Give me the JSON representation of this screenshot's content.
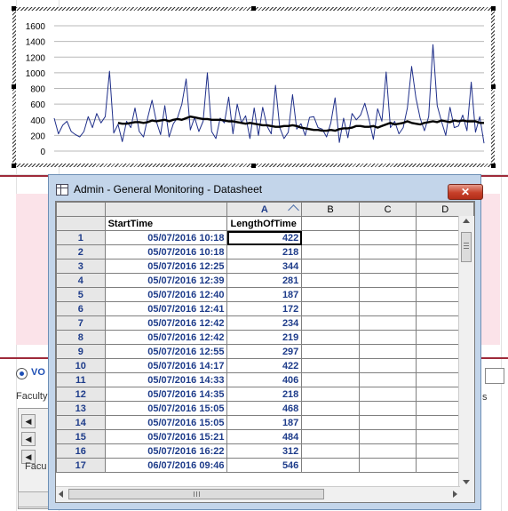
{
  "chart_data": {
    "type": "line",
    "y_ticks": [
      "0",
      "200",
      "400",
      "600",
      "800",
      "1000",
      "1200",
      "1400",
      "1600"
    ],
    "ylim": [
      0,
      1600
    ],
    "grid": true,
    "series": [
      {
        "style": "thin navy line",
        "values": [
          420,
          220,
          330,
          380,
          250,
          210,
          180,
          250,
          440,
          300,
          480,
          360,
          440,
          1020,
          230,
          340,
          120,
          380,
          300,
          550,
          250,
          180,
          430,
          650,
          380,
          210,
          580,
          180,
          350,
          430,
          600,
          920,
          270,
          430,
          250,
          380,
          1000,
          250,
          160,
          420,
          360,
          690,
          220,
          600,
          360,
          450,
          160,
          550,
          200,
          560,
          320,
          220,
          840,
          300,
          160,
          240,
          720,
          280,
          350,
          200,
          430,
          440,
          300,
          280,
          180,
          360,
          680,
          110,
          420,
          170,
          480,
          400,
          460,
          610,
          400,
          150,
          540,
          380,
          1010,
          300,
          380,
          220,
          300,
          550,
          1080,
          680,
          420,
          260,
          440,
          1360,
          580,
          380,
          200,
          560,
          300,
          320,
          460,
          260,
          880,
          240,
          440,
          100
        ]
      },
      {
        "style": "thick black trend line",
        "values": [
          null,
          null,
          null,
          null,
          null,
          null,
          null,
          null,
          null,
          null,
          null,
          null,
          null,
          null,
          null,
          360,
          350,
          350,
          360,
          370,
          370,
          360,
          370,
          390,
          380,
          390,
          400,
          380,
          400,
          410,
          400,
          420,
          440,
          430,
          420,
          410,
          410,
          400,
          400,
          400,
          390,
          380,
          380,
          370,
          360,
          350,
          360,
          350,
          340,
          330,
          330,
          320,
          310,
          310,
          320,
          320,
          330,
          320,
          300,
          290,
          280,
          270,
          270,
          260,
          260,
          270,
          260,
          280,
          290,
          290,
          300,
          320,
          320,
          310,
          310,
          320,
          300,
          320,
          340,
          360,
          340,
          350,
          360,
          380,
          360,
          350,
          340,
          360,
          370,
          380,
          370,
          390,
          380,
          370,
          390,
          380,
          390,
          380,
          380,
          380,
          360,
          360
        ]
      }
    ]
  },
  "window": {
    "title": "Admin - General Monitoring - Datasheet",
    "close_label": "✕"
  },
  "sheet": {
    "col_letters": [
      "A",
      "B",
      "C",
      "D"
    ],
    "field_startTime": "StartTime",
    "field_length": "LengthOfTime",
    "rows": [
      {
        "n": "1",
        "start": "05/07/2016 10:18",
        "len": "422"
      },
      {
        "n": "2",
        "start": "05/07/2016 10:18",
        "len": "218"
      },
      {
        "n": "3",
        "start": "05/07/2016 12:25",
        "len": "344"
      },
      {
        "n": "4",
        "start": "05/07/2016 12:39",
        "len": "281"
      },
      {
        "n": "5",
        "start": "05/07/2016 12:40",
        "len": "187"
      },
      {
        "n": "6",
        "start": "05/07/2016 12:41",
        "len": "172"
      },
      {
        "n": "7",
        "start": "05/07/2016 12:42",
        "len": "234"
      },
      {
        "n": "8",
        "start": "05/07/2016 12:42",
        "len": "219"
      },
      {
        "n": "9",
        "start": "05/07/2016 12:55",
        "len": "297"
      },
      {
        "n": "10",
        "start": "05/07/2016 14:17",
        "len": "422"
      },
      {
        "n": "11",
        "start": "05/07/2016 14:33",
        "len": "406"
      },
      {
        "n": "12",
        "start": "05/07/2016 14:35",
        "len": "218"
      },
      {
        "n": "13",
        "start": "05/07/2016 15:05",
        "len": "468"
      },
      {
        "n": "14",
        "start": "05/07/2016 15:05",
        "len": "187"
      },
      {
        "n": "15",
        "start": "05/07/2016 15:21",
        "len": "484"
      },
      {
        "n": "16",
        "start": "05/07/2016 16:22",
        "len": "312"
      },
      {
        "n": "17",
        "start": "06/07/2016 09:46",
        "len": "546"
      }
    ]
  },
  "background": {
    "radio_label": "VO",
    "faculty_label": "Faculty",
    "faculty_label2": "Facu",
    "right_label": "s"
  }
}
